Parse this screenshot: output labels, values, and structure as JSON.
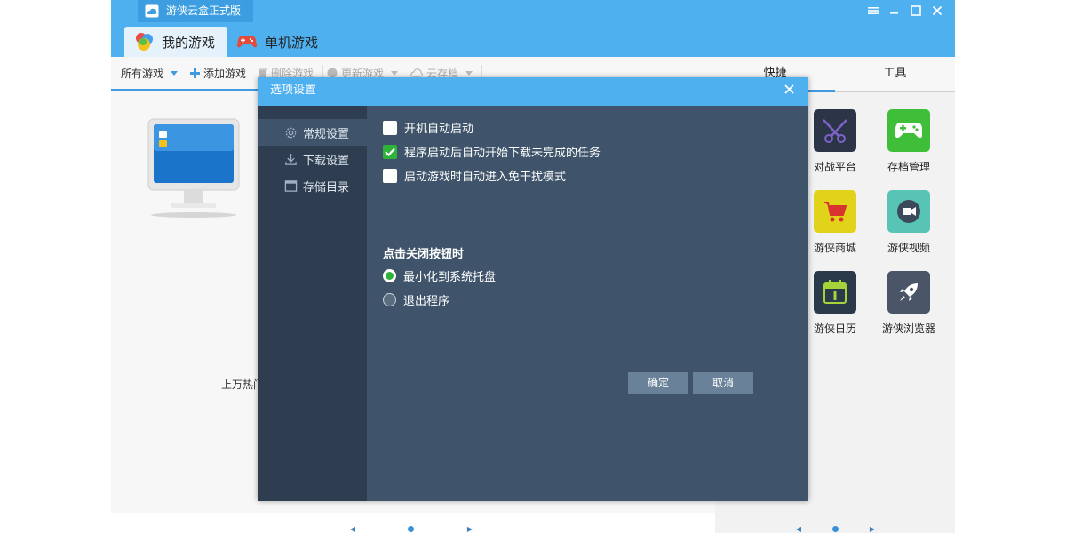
{
  "app": {
    "title": "游侠云盒正式版",
    "tabs": [
      {
        "label": "我的游戏",
        "icon": "ball-logo-icon",
        "active": true
      },
      {
        "label": "单机游戏",
        "icon": "gamepad-icon",
        "active": false
      }
    ]
  },
  "toolbar": {
    "all_games": "所有游戏",
    "add_game": "添加游戏",
    "delete_game": "删除游戏",
    "update_game": "更新游戏",
    "cloud_save": "云存档"
  },
  "left": {
    "hot_text": "上万热门"
  },
  "right_panel": {
    "tabs": [
      "快捷",
      "工具"
    ],
    "tools": [
      {
        "label": "对战平台",
        "icon": "crossed-swords-icon",
        "color": "#2b3547"
      },
      {
        "label": "存档管理",
        "icon": "gamepad-icon",
        "color": "#3fbf39"
      },
      {
        "label": "游侠商城",
        "icon": "shopping-cart-icon",
        "color": "#e1d21a"
      },
      {
        "label": "游侠视频",
        "icon": "video-icon",
        "color": "#58c4b6"
      },
      {
        "label": "游侠日历",
        "icon": "calendar-icon",
        "color": "#2b3a4a"
      },
      {
        "label": "游侠浏览器",
        "icon": "rocket-icon",
        "color": "#4a5568"
      }
    ]
  },
  "dialog": {
    "title": "选项设置",
    "nav": [
      {
        "label": "常规设置",
        "icon": "gear-icon",
        "active": true
      },
      {
        "label": "下载设置",
        "icon": "download-icon",
        "active": false
      },
      {
        "label": "存储目录",
        "icon": "folder-window-icon",
        "active": false
      }
    ],
    "options": [
      {
        "label": "开机自动启动",
        "checked": false
      },
      {
        "label": "程序启动后自动开始下载未完成的任务",
        "checked": true
      },
      {
        "label": "启动游戏时自动进入免干扰模式",
        "checked": false
      }
    ],
    "close_section_title": "点击关闭按钮时",
    "close_options": [
      {
        "label": "最小化到系统托盘",
        "selected": true
      },
      {
        "label": "退出程序",
        "selected": false
      }
    ],
    "ok_label": "确定",
    "cancel_label": "取消"
  },
  "colors": {
    "accent": "#4fb0f0",
    "dialog_bg": "#3f546b",
    "nav_bg": "#2e3e50",
    "check_green": "#2fb33a"
  }
}
